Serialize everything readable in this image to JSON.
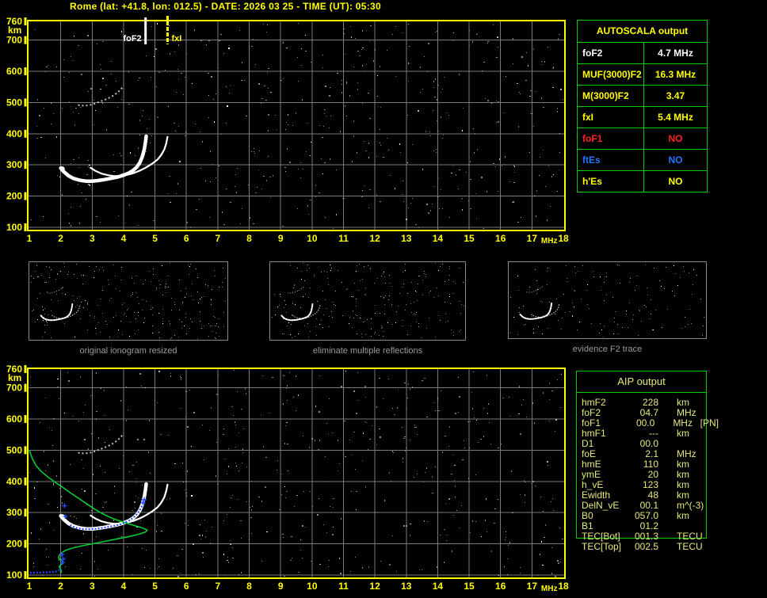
{
  "header": {
    "title": "Rome (lat: +41.8, lon: 012.5) - DATE: 2026 03 25 - TIME (UT): 05:30"
  },
  "colors": {
    "accent_yellow": "#ffff00",
    "grid_gray": "#7a7a7a",
    "table_green": "#00d000",
    "trace_white": "#ffffff",
    "second_hop_gray": "#c0c0c0",
    "profile_green": "#00cc33",
    "restored_blue": "#2b4bff",
    "red": "#ff2222",
    "blue_text": "#2277ff",
    "aip_text": "#e8e87c",
    "thumb_border": "#8a8a8a",
    "thumb_label": "#9a9a9a"
  },
  "autoscala": {
    "title": "AUTOSCALA output",
    "rows": [
      {
        "label": "foF2",
        "value": "4.7 MHz",
        "color": "#ffffff"
      },
      {
        "label": "MUF(3000)F2",
        "value": "16.3 MHz",
        "color": "#ffff00"
      },
      {
        "label": "M(3000)F2",
        "value": "3.47",
        "color": "#ffff00"
      },
      {
        "label": "fxI",
        "value": "5.4 MHz",
        "color": "#ffff00"
      },
      {
        "label": "foF1",
        "value": "NO",
        "color": "#ff2222"
      },
      {
        "label": "ftEs",
        "value": "NO",
        "color": "#2277ff"
      },
      {
        "label": "h'Es",
        "value": "NO",
        "color": "#ffff00"
      }
    ]
  },
  "aip": {
    "title": "AIP output",
    "rows": [
      {
        "label": "hmF2",
        "value": "228",
        "unit": "km",
        "extra": ""
      },
      {
        "label": "foF2",
        "value": "04.7",
        "unit": "MHz",
        "extra": ""
      },
      {
        "label": "foF1",
        "value": "00.0",
        "unit": "MHz",
        "extra": "[PN]"
      },
      {
        "label": "hmF1",
        "value": "---",
        "unit": "km",
        "extra": ""
      },
      {
        "label": "D1",
        "value": "00.0",
        "unit": "",
        "extra": ""
      },
      {
        "label": "foE",
        "value": "2.1",
        "unit": "MHz",
        "extra": ""
      },
      {
        "label": "hmE",
        "value": "110",
        "unit": "km",
        "extra": ""
      },
      {
        "label": "ymE",
        "value": "20",
        "unit": "km",
        "extra": ""
      },
      {
        "label": "h_vE",
        "value": "123",
        "unit": "km",
        "extra": ""
      },
      {
        "label": "Ewidth",
        "value": "48",
        "unit": "km",
        "extra": ""
      },
      {
        "label": "DelN_vE",
        "value": "00.1",
        "unit": "m^(-3)",
        "extra": ""
      },
      {
        "label": "B0",
        "value": "057.0",
        "unit": "km",
        "extra": ""
      },
      {
        "label": "B1",
        "value": "01.2",
        "unit": "",
        "extra": ""
      },
      {
        "label": "TEC[Bot]",
        "value": "001.3",
        "unit": "TECU",
        "extra": ""
      },
      {
        "label": "TEC[Top]",
        "value": "002.5",
        "unit": "TECU",
        "extra": ""
      }
    ]
  },
  "thumbnails": [
    {
      "label": "original ionogram resized"
    },
    {
      "label": "eliminate multiple reflections"
    },
    {
      "label": "evidence F2 trace"
    }
  ],
  "chart_data": {
    "type": "scatter",
    "title": "ionogram virtual height vs frequency",
    "x_axis": {
      "label": "MHz",
      "min": 1,
      "max": 18,
      "ticks": [
        1,
        2,
        3,
        4,
        5,
        6,
        7,
        8,
        9,
        10,
        11,
        12,
        13,
        14,
        15,
        16,
        17,
        18
      ]
    },
    "y_axis": {
      "label": "km",
      "min": 100,
      "max": 760,
      "ticks": [
        760,
        700,
        600,
        500,
        400,
        300,
        200,
        100
      ]
    },
    "markers": [
      {
        "name": "foF2",
        "mhz": 4.7,
        "color": "#ffffff"
      },
      {
        "name": "fxI",
        "mhz": 5.4,
        "color": "#ffff00"
      }
    ],
    "traces": {
      "f2_ordinary": [
        [
          2.0,
          290
        ],
        [
          2.1,
          278
        ],
        [
          2.25,
          265
        ],
        [
          2.4,
          257
        ],
        [
          2.6,
          251
        ],
        [
          2.8,
          248
        ],
        [
          3.0,
          248
        ],
        [
          3.2,
          250
        ],
        [
          3.4,
          253
        ],
        [
          3.6,
          257
        ],
        [
          3.8,
          261
        ],
        [
          4.0,
          267
        ],
        [
          4.15,
          273
        ],
        [
          4.3,
          282
        ],
        [
          4.42,
          293
        ],
        [
          4.52,
          308
        ],
        [
          4.6,
          327
        ],
        [
          4.66,
          350
        ],
        [
          4.7,
          375
        ],
        [
          4.72,
          392
        ]
      ],
      "f2_extraordinary": [
        [
          2.95,
          291
        ],
        [
          3.1,
          281
        ],
        [
          3.3,
          272
        ],
        [
          3.5,
          267
        ],
        [
          3.7,
          264
        ],
        [
          3.9,
          265
        ],
        [
          4.1,
          268
        ],
        [
          4.3,
          273
        ],
        [
          4.5,
          281
        ],
        [
          4.7,
          291
        ],
        [
          4.9,
          303
        ],
        [
          5.08,
          317
        ],
        [
          5.2,
          332
        ],
        [
          5.3,
          350
        ],
        [
          5.36,
          370
        ],
        [
          5.4,
          390
        ]
      ],
      "second_hop": [
        [
          2.55,
          492
        ],
        [
          2.7,
          490
        ],
        [
          2.9,
          491
        ],
        [
          3.1,
          497
        ],
        [
          3.3,
          505
        ],
        [
          3.5,
          513
        ],
        [
          3.65,
          521
        ],
        [
          3.8,
          531
        ],
        [
          3.92,
          543
        ],
        [
          4.0,
          554
        ]
      ],
      "left_blob": [
        2.05,
        287
      ]
    },
    "profile": {
      "electron_density_green": [
        [
          1.0,
          500
        ],
        [
          1.1,
          472
        ],
        [
          1.22,
          450
        ],
        [
          1.38,
          432
        ],
        [
          1.58,
          415
        ],
        [
          1.8,
          399
        ],
        [
          2.05,
          382
        ],
        [
          2.3,
          364
        ],
        [
          2.55,
          347
        ],
        [
          2.8,
          330
        ],
        [
          3.05,
          313
        ],
        [
          3.3,
          298
        ],
        [
          3.55,
          286
        ],
        [
          3.8,
          276
        ],
        [
          4.05,
          268
        ],
        [
          4.3,
          260
        ],
        [
          4.5,
          254
        ],
        [
          4.65,
          249
        ],
        [
          4.75,
          244
        ],
        [
          4.7,
          238
        ],
        [
          4.5,
          231
        ],
        [
          4.2,
          224
        ],
        [
          3.8,
          216
        ],
        [
          3.4,
          208
        ],
        [
          3.0,
          200
        ],
        [
          2.65,
          193
        ],
        [
          2.35,
          186
        ],
        [
          2.15,
          179
        ],
        [
          2.02,
          171
        ],
        [
          1.95,
          163
        ],
        [
          1.93,
          155
        ],
        [
          1.99,
          149
        ],
        [
          2.06,
          144
        ],
        [
          2.07,
          138
        ],
        [
          2.0,
          133
        ],
        [
          1.95,
          128
        ],
        [
          1.97,
          122
        ],
        [
          2.01,
          116
        ],
        [
          2.02,
          110
        ],
        [
          1.98,
          106
        ]
      ],
      "blue_restored_trace": [
        [
          2.3,
          260
        ],
        [
          2.4,
          255
        ],
        [
          2.5,
          251
        ],
        [
          2.65,
          248
        ],
        [
          2.8,
          247
        ],
        [
          2.95,
          247
        ],
        [
          3.1,
          248
        ],
        [
          3.25,
          250
        ],
        [
          3.4,
          252
        ],
        [
          3.55,
          255
        ],
        [
          3.7,
          258
        ],
        [
          3.85,
          261
        ],
        [
          4.0,
          266
        ],
        [
          4.1,
          271
        ],
        [
          4.2,
          276
        ],
        [
          4.3,
          283
        ],
        [
          4.4,
          292
        ],
        [
          4.5,
          305
        ],
        [
          4.58,
          320
        ],
        [
          4.64,
          333
        ]
      ],
      "blue_plus_markers": [
        [
          2.12,
          322
        ],
        [
          2.15,
          288
        ],
        [
          4.62,
          332
        ],
        [
          4.66,
          342
        ]
      ],
      "blue_e_trace": [
        [
          1.02,
          107
        ],
        [
          1.1,
          107
        ],
        [
          1.2,
          108
        ],
        [
          1.3,
          108
        ],
        [
          1.4,
          108
        ],
        [
          1.5,
          109
        ],
        [
          1.6,
          109
        ],
        [
          1.7,
          110
        ],
        [
          1.8,
          110
        ],
        [
          1.88,
          112
        ],
        [
          1.95,
          116
        ],
        [
          2.0,
          122
        ]
      ],
      "blue_e_plus_markers": [
        [
          2.05,
          140
        ],
        [
          2.08,
          152
        ],
        [
          2.04,
          166
        ]
      ]
    }
  }
}
